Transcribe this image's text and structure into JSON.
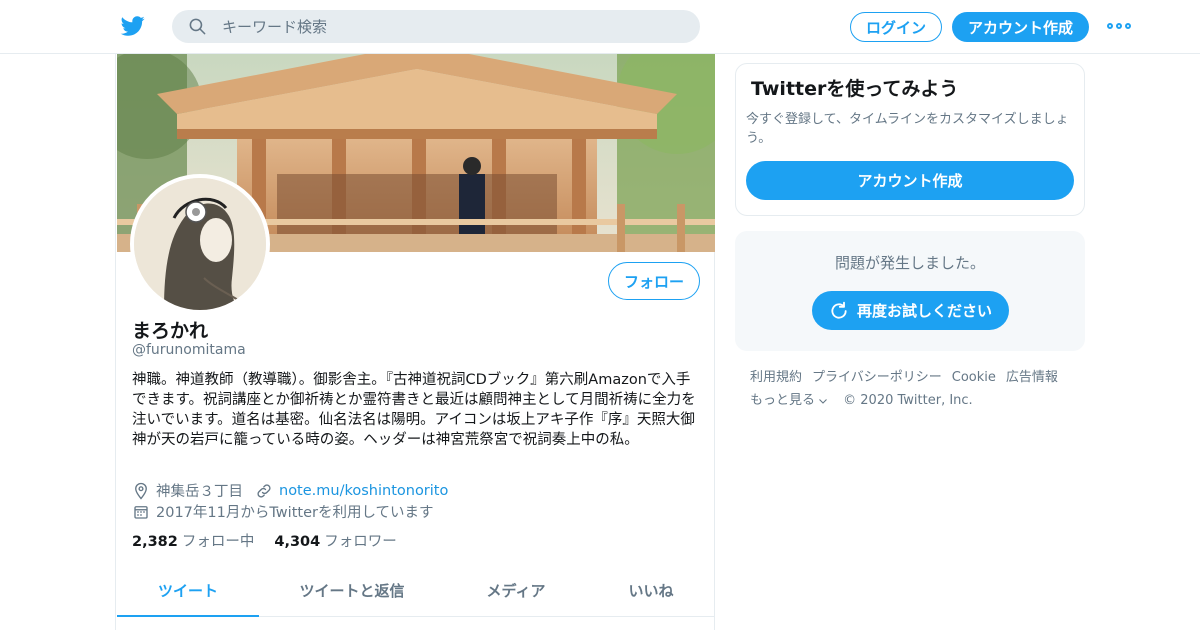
{
  "search": {
    "placeholder": "キーワード検索"
  },
  "header": {
    "login_label": "ログイン",
    "signup_label": "アカウント作成"
  },
  "profile": {
    "follow_label": "フォロー",
    "name": "まろかれ",
    "handle": "@furunomitama",
    "bio": "神職。神道教師（教導職）。御影舎主。『古神道祝詞CDブック』第六刷Amazonで入手できます。祝詞講座とか御祈祷とか霊符書きと最近は顧問神主として月間祈祷に全力を注いでいます。道名は基密。仙名法名は陽明。アイコンは坂上アキ子作『序』天照大御神が天の岩戸に籠っている時の姿。ヘッダーは神宮荒祭宮で祝詞奏上中の私。",
    "location": "神集岳３丁目",
    "link": "note.mu/koshintonorito",
    "joined": "2017年11月からTwitterを利用しています",
    "following_count": "2,382",
    "following_label": "フォロー中",
    "followers_count": "4,304",
    "followers_label": "フォロワー"
  },
  "tabs": [
    {
      "label": "ツイート",
      "active": true
    },
    {
      "label": "ツイートと返信",
      "active": false
    },
    {
      "label": "メディア",
      "active": false
    },
    {
      "label": "いいね",
      "active": false
    }
  ],
  "join_card": {
    "title": "Twitterを使ってみよう",
    "text": "今すぐ登録して、タイムラインをカスタマイズしましょう。",
    "button_label": "アカウント作成"
  },
  "error_card": {
    "message": "問題が発生しました。",
    "retry_label": "再度お試しください"
  },
  "footer": {
    "links": [
      "利用規約",
      "プライバシーポリシー",
      "Cookie",
      "広告情報"
    ],
    "more_label": "もっと見る",
    "copyright": "© 2020 Twitter, Inc."
  },
  "colors": {
    "accent": "#1da1f2",
    "secondary_text": "#657786",
    "border": "#e6ecf0"
  }
}
